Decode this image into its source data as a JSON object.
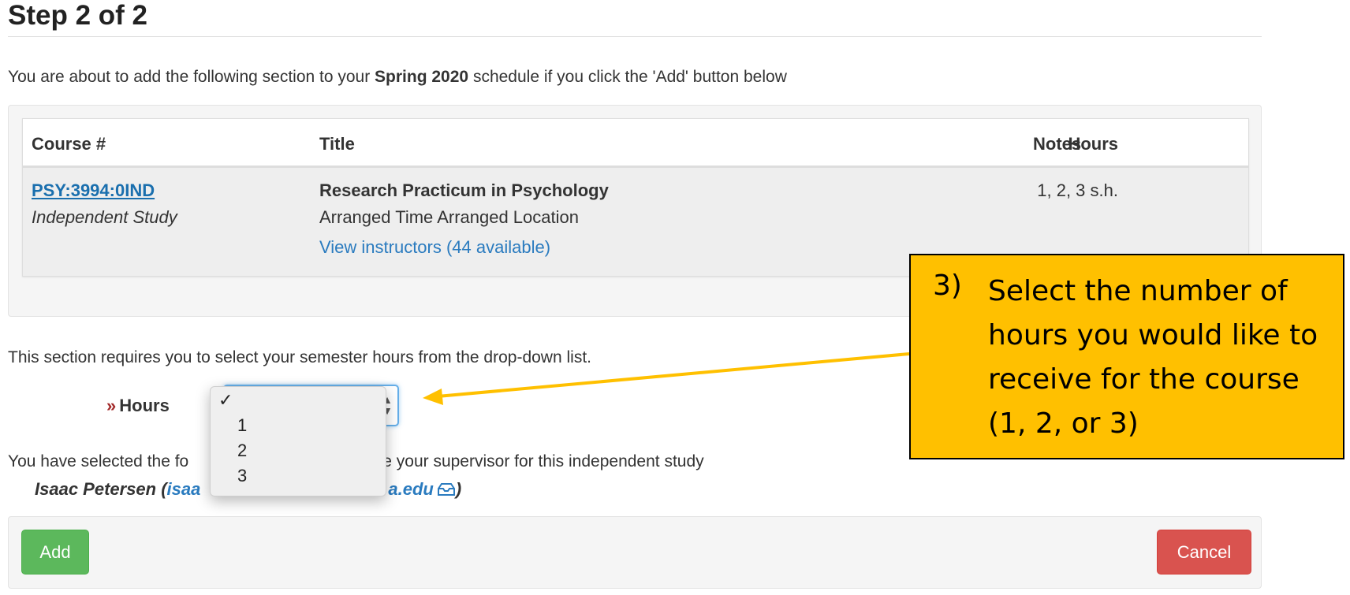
{
  "page": {
    "title": "Step 2 of 2"
  },
  "intro": {
    "prefix": "You are about to add the following section to your ",
    "term": "Spring 2020",
    "suffix": " schedule if you click the 'Add' button below"
  },
  "course_table": {
    "headers": {
      "course": "Course #",
      "title": "Title",
      "hours": "Hours",
      "notes": "Notes"
    },
    "row": {
      "course_number": "PSY:3994:0IND",
      "course_type": "Independent Study",
      "title": "Research Practicum in Psychology",
      "meeting": "Arranged Time Arranged Location",
      "instructors_link": "View instructors (44 available)",
      "hours": "1, 2, 3 s.h.",
      "notes": ""
    }
  },
  "hours_section": {
    "requires_text": "This section requires you to select your semester hours from the drop-down list.",
    "label": "Hours",
    "chevron": "»",
    "selected_value": "",
    "options": [
      "1",
      "2",
      "3"
    ],
    "check_mark": "✓"
  },
  "supervisor_section": {
    "text_visible_start": "You have selected the fo",
    "text_visible_end": "e your supervisor for this independent study",
    "name_prefix": "Isaac Petersen (",
    "email_start": "isaa",
    "email_end": "a.edu",
    "name_suffix": ")",
    "icon": "mail-inbox-icon"
  },
  "buttons": {
    "add": "Add",
    "cancel": "Cancel"
  },
  "callout": {
    "number": "3)",
    "text": "Select the number of hours you would like to receive for the course (1, 2, or 3)"
  },
  "colors": {
    "link": "#1a6fae",
    "add_button": "#5cb85c",
    "cancel_button": "#d9534f",
    "callout_fill": "#ffc000",
    "arrow": "#ffc000",
    "chevron": "#a32a2a"
  }
}
